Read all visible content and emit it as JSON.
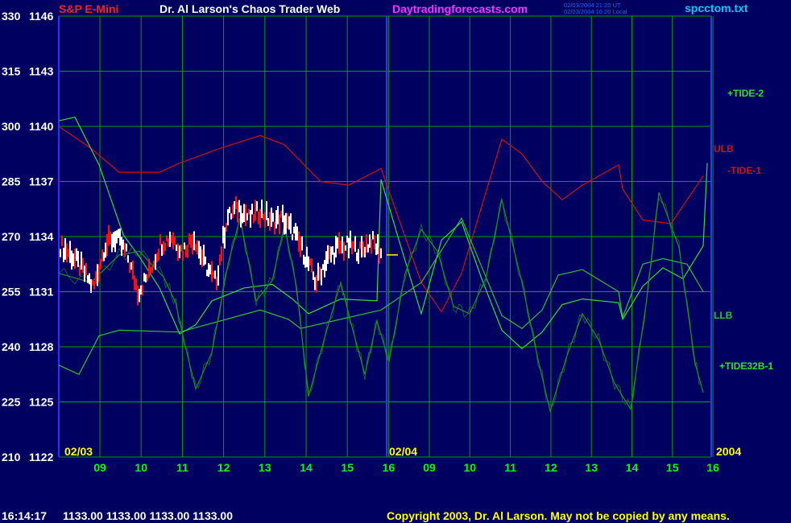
{
  "header": {
    "instrument": "S&P E-Mini",
    "title": "Dr. Al Larson's Chaos Trader Web",
    "site": "Daytradingforecasts.com",
    "stamp_line1": "02/03/2004 21:20 UT",
    "stamp_line2": "02/03/2004 16:20 Local",
    "filename": "spcctom.txt"
  },
  "footer": {
    "time": "16:14:17",
    "quote": "1133.00 1133.00 1133.00 1133.00",
    "copyright": "Copyright 2003, Dr. Al Larson. May not be copied by any means."
  },
  "colors": {
    "background": "#000060",
    "grid": "#00a000",
    "axis_text": "#ffffff",
    "date_text": "#ffff00",
    "hour_text": "#00ff00",
    "instrument": "#ff2020",
    "site": "#ff30ff",
    "filename": "#00ccff",
    "divider": "#3030ff",
    "ulb": "#d01010",
    "llb": "#30c030",
    "tide2": "#30e030",
    "tide1": "#d02020",
    "tide32b": "#209020",
    "bar_up": "#ffffff",
    "bar_down": "#ff1010",
    "avg": "#ffff00"
  },
  "chart_data": {
    "type": "line",
    "y_left_labels": [
      "330",
      "315",
      "300",
      "285",
      "270",
      "255",
      "240",
      "225",
      "210"
    ],
    "y_right_labels": [
      "1146",
      "1143",
      "1140",
      "1137",
      "1134",
      "1131",
      "1128",
      "1125",
      "1122"
    ],
    "ylim": [
      1122,
      1146
    ],
    "x_hour_labels": [
      "09",
      "10",
      "11",
      "12",
      "13",
      "14",
      "15",
      "16",
      "09",
      "10",
      "11",
      "12",
      "13",
      "14",
      "15",
      "16"
    ],
    "date_labels": [
      "02/03",
      "02/04",
      "2004"
    ],
    "series_labels": [
      "+TIDE-2",
      "ULB",
      "-TIDE-1",
      "LLB",
      "+TIDE32B-1"
    ],
    "current_price": 1133.0,
    "series": [
      {
        "name": "ULB",
        "points": [
          [
            0,
            1140
          ],
          [
            0.8,
            1138.8
          ],
          [
            1.5,
            1137.5
          ],
          [
            2.5,
            1137.5
          ],
          [
            3,
            1138
          ],
          [
            4,
            1138.8
          ],
          [
            5,
            1139.5
          ],
          [
            5.6,
            1139
          ],
          [
            6.5,
            1137
          ],
          [
            7.2,
            1136.8
          ],
          [
            8,
            1137.7
          ],
          [
            9,
            1131.5
          ],
          [
            9.5,
            1129.9
          ],
          [
            10,
            1132
          ],
          [
            11,
            1139.3
          ],
          [
            11.5,
            1138.5
          ],
          [
            12,
            1137
          ],
          [
            12.5,
            1136
          ],
          [
            13,
            1136.8
          ],
          [
            13.9,
            1137.9
          ],
          [
            14,
            1136.6
          ],
          [
            14.5,
            1134.9
          ],
          [
            15.2,
            1134.7
          ],
          [
            16,
            1137.3
          ]
        ]
      },
      {
        "name": "LLB",
        "points": [
          [
            0,
            1127
          ],
          [
            0.5,
            1126.5
          ],
          [
            1,
            1128.6
          ],
          [
            1.5,
            1128.9
          ],
          [
            3,
            1128.8
          ],
          [
            4,
            1129.4
          ],
          [
            5,
            1130
          ],
          [
            5.7,
            1129.5
          ],
          [
            6,
            1129
          ],
          [
            8,
            1130
          ],
          [
            9,
            1131.5
          ],
          [
            10,
            1135
          ],
          [
            11,
            1129.7
          ],
          [
            11.5,
            1129
          ],
          [
            12,
            1130
          ],
          [
            12.4,
            1131.9
          ],
          [
            13,
            1132.2
          ],
          [
            13.9,
            1131
          ],
          [
            14,
            1129.6
          ],
          [
            14.5,
            1132.5
          ],
          [
            15,
            1132.8
          ],
          [
            15.6,
            1132.5
          ],
          [
            16,
            1131
          ]
        ]
      },
      {
        "name": "+TIDE-2",
        "points": [
          [
            0,
            1140.3
          ],
          [
            0.4,
            1140.5
          ],
          [
            1,
            1137.9
          ],
          [
            1.6,
            1134.1
          ],
          [
            2,
            1132.9
          ],
          [
            2.5,
            1131.2
          ],
          [
            3,
            1128.7
          ],
          [
            3.4,
            1129.2
          ],
          [
            3.8,
            1130.5
          ],
          [
            4.6,
            1131.2
          ],
          [
            5.3,
            1131.4
          ],
          [
            5.8,
            1130.6
          ],
          [
            6.2,
            1129.8
          ],
          [
            7,
            1130.6
          ],
          [
            7.9,
            1130.5
          ],
          [
            8,
            1137.1
          ],
          [
            8.5,
            1133.4
          ],
          [
            9,
            1129.8
          ],
          [
            9.5,
            1133.8
          ],
          [
            10,
            1134.8
          ],
          [
            10.5,
            1131.7
          ],
          [
            11,
            1128.9
          ],
          [
            11.5,
            1127.9
          ],
          [
            12,
            1128.8
          ],
          [
            12.5,
            1130.3
          ],
          [
            13,
            1130.6
          ],
          [
            13.9,
            1130.4
          ],
          [
            14,
            1129.5
          ],
          [
            14.5,
            1131.3
          ],
          [
            15,
            1132.3
          ],
          [
            15.5,
            1131.7
          ],
          [
            16,
            1133.5
          ],
          [
            16.1,
            1138
          ]
        ]
      },
      {
        "name": "+TIDE32B-1",
        "points": [
          [
            0,
            1132
          ],
          [
            0.8,
            1131.5
          ],
          [
            1.5,
            1133
          ],
          [
            2,
            1133.2
          ],
          [
            2.6,
            1131.8
          ],
          [
            2.9,
            1130.4
          ],
          [
            3.1,
            1128.4
          ],
          [
            3.4,
            1125.7
          ],
          [
            3.8,
            1127.7
          ],
          [
            4.2,
            1132.5
          ],
          [
            4.5,
            1135
          ],
          [
            4.9,
            1130.5
          ],
          [
            5.3,
            1131.6
          ],
          [
            5.6,
            1134.6
          ],
          [
            5.9,
            1131.3
          ],
          [
            6.2,
            1125.3
          ],
          [
            6.6,
            1128.5
          ],
          [
            7,
            1131.5
          ],
          [
            7.3,
            1128.9
          ],
          [
            7.6,
            1126.5
          ],
          [
            7.9,
            1129.4
          ],
          [
            8.2,
            1127.2
          ],
          [
            8.6,
            1132
          ],
          [
            9,
            1134.4
          ],
          [
            9.4,
            1133.2
          ],
          [
            9.8,
            1130.2
          ],
          [
            10.2,
            1129.8
          ],
          [
            10.6,
            1131.7
          ],
          [
            11,
            1136
          ],
          [
            11.5,
            1131.5
          ],
          [
            11.9,
            1127.3
          ],
          [
            12.2,
            1124.5
          ],
          [
            12.6,
            1127.4
          ],
          [
            13,
            1129.8
          ],
          [
            13.4,
            1128.4
          ],
          [
            13.8,
            1126
          ],
          [
            14.2,
            1124.6
          ],
          [
            14.6,
            1130.6
          ],
          [
            14.9,
            1136.4
          ],
          [
            15.4,
            1133.4
          ],
          [
            15.8,
            1127.1
          ],
          [
            16,
            1125.5
          ]
        ]
      }
    ]
  }
}
